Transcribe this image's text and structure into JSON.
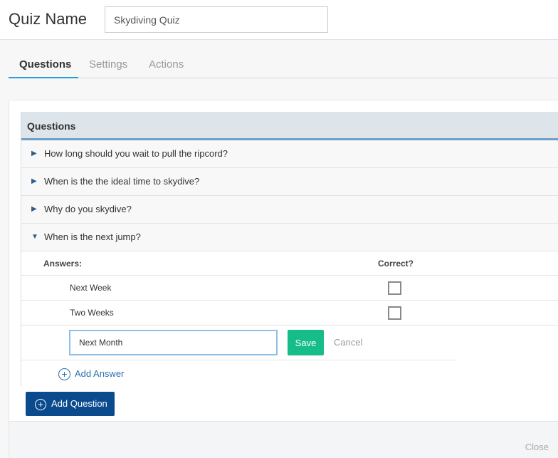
{
  "header": {
    "quiz_name_label": "Quiz Name",
    "quiz_name_value": "Skydiving Quiz"
  },
  "tabs": [
    {
      "label": "Questions",
      "active": true
    },
    {
      "label": "Settings",
      "active": false
    },
    {
      "label": "Actions",
      "active": false
    }
  ],
  "panel": {
    "title": "Questions",
    "questions": [
      {
        "text": "How long should you wait to pull the ripcord?",
        "expanded": false
      },
      {
        "text": "When is the the ideal time to skydive?",
        "expanded": false
      },
      {
        "text": "Why do you skydive?",
        "expanded": false
      },
      {
        "text": "When is the next jump?",
        "expanded": true
      }
    ],
    "answers_header": "Answers:",
    "correct_header": "Correct?",
    "answers": [
      {
        "text": "Next Week",
        "correct": false
      },
      {
        "text": "Two Weeks",
        "correct": false
      }
    ],
    "edit_value": "Next Month",
    "save_label": "Save",
    "cancel_label": "Cancel",
    "add_answer_label": "Add Answer"
  },
  "add_question_label": "Add Question",
  "close_label": "Close",
  "colors": {
    "accent": "#2a9fd6",
    "save": "#17bd88",
    "primary": "#0c4a8e",
    "link": "#2b6fb0"
  }
}
